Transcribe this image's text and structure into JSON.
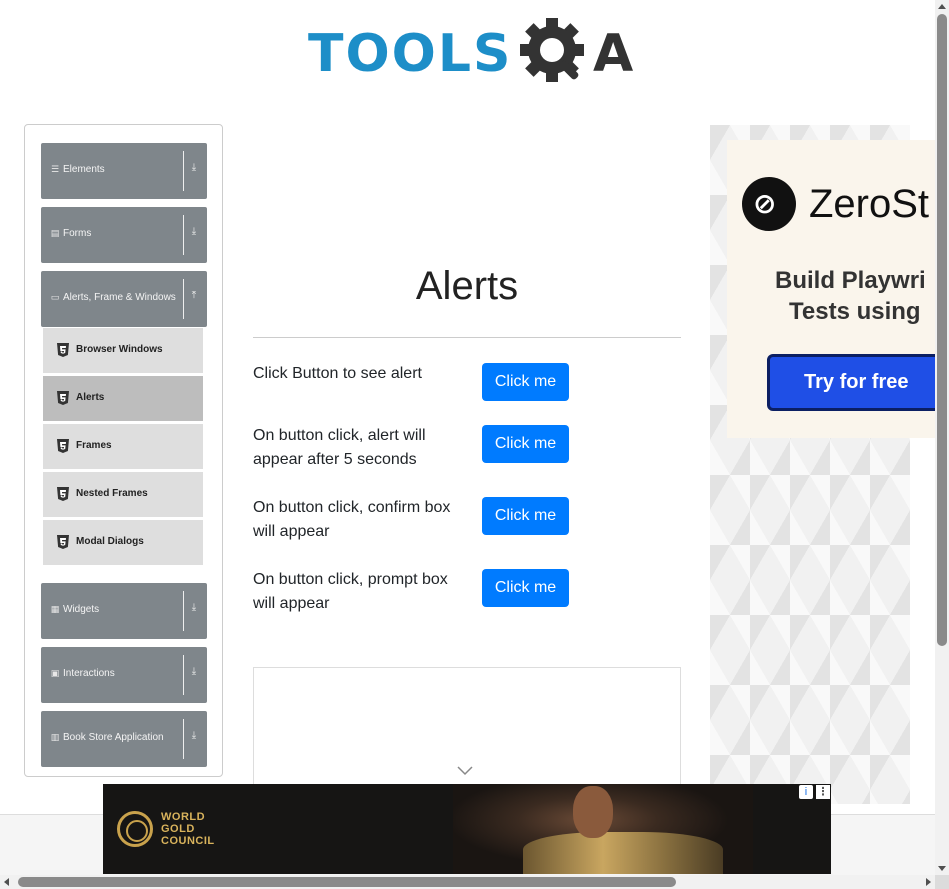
{
  "header": {
    "logo_text": "TOOLS",
    "logo_suffix": "A"
  },
  "sidebar": {
    "groups": [
      {
        "label": "Elements",
        "icon": "hamburger-icon"
      },
      {
        "label": "Forms",
        "icon": "form-icon"
      },
      {
        "label": "Alerts, Frame & Windows",
        "icon": "window-icon",
        "expanded": true
      },
      {
        "label": "Widgets",
        "icon": "grid-icon"
      },
      {
        "label": "Interactions",
        "icon": "interaction-icon"
      },
      {
        "label": "Book Store Application",
        "icon": "bookstore-icon"
      }
    ],
    "subitems": [
      {
        "label": "Browser Windows",
        "icon": "html5-icon"
      },
      {
        "label": "Alerts",
        "icon": "html5-icon",
        "active": true
      },
      {
        "label": "Frames",
        "icon": "html5-icon"
      },
      {
        "label": "Nested Frames",
        "icon": "html5-icon"
      },
      {
        "label": "Modal Dialogs",
        "icon": "html5-icon"
      }
    ]
  },
  "main": {
    "title": "Alerts",
    "rows": [
      {
        "text": "Click Button to see alert",
        "button": "Click me"
      },
      {
        "text": "On button click, alert will appear after 5 seconds",
        "button": "Click me"
      },
      {
        "text": "On button click, confirm box will appear",
        "button": "Click me"
      },
      {
        "text": "On button click, prompt box will appear",
        "button": "Click me"
      }
    ]
  },
  "right_ad": {
    "brand": "ZeroSt",
    "headline_line1": "Build Playwri",
    "headline_line2": "Tests using",
    "cta": "Try for free"
  },
  "bottom_ad": {
    "brand_line1": "WORLD",
    "brand_line2": "GOLD",
    "brand_line3": "COUNCIL",
    "info": "i",
    "menu": "⋮"
  },
  "colors": {
    "primary_button": "#007bff",
    "sidebar_group": "#7f868b",
    "logo_blue": "#1d8ec8"
  }
}
